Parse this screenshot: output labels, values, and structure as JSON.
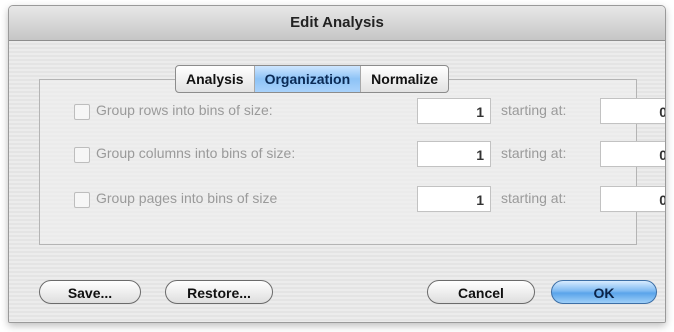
{
  "window": {
    "title": "Edit Analysis"
  },
  "tabs": [
    {
      "label": "Analysis",
      "active": false
    },
    {
      "label": "Organization",
      "active": true
    },
    {
      "label": "Normalize",
      "active": false
    }
  ],
  "rows": [
    {
      "label": "Group rows into bins of size:",
      "bin_size": "1",
      "starting_label": "starting at:",
      "start": "0",
      "checked": false
    },
    {
      "label": "Group columns into bins of size:",
      "bin_size": "1",
      "starting_label": "starting at:",
      "start": "0",
      "checked": false
    },
    {
      "label": "Group pages into bins of size",
      "bin_size": "1",
      "starting_label": "starting at:",
      "start": "0",
      "checked": false
    }
  ],
  "buttons": {
    "save": "Save...",
    "restore": "Restore...",
    "cancel": "Cancel",
    "ok": "OK"
  },
  "colors": {
    "accent": "#7fbaf2",
    "disabled_text": "#9a9a9a"
  }
}
